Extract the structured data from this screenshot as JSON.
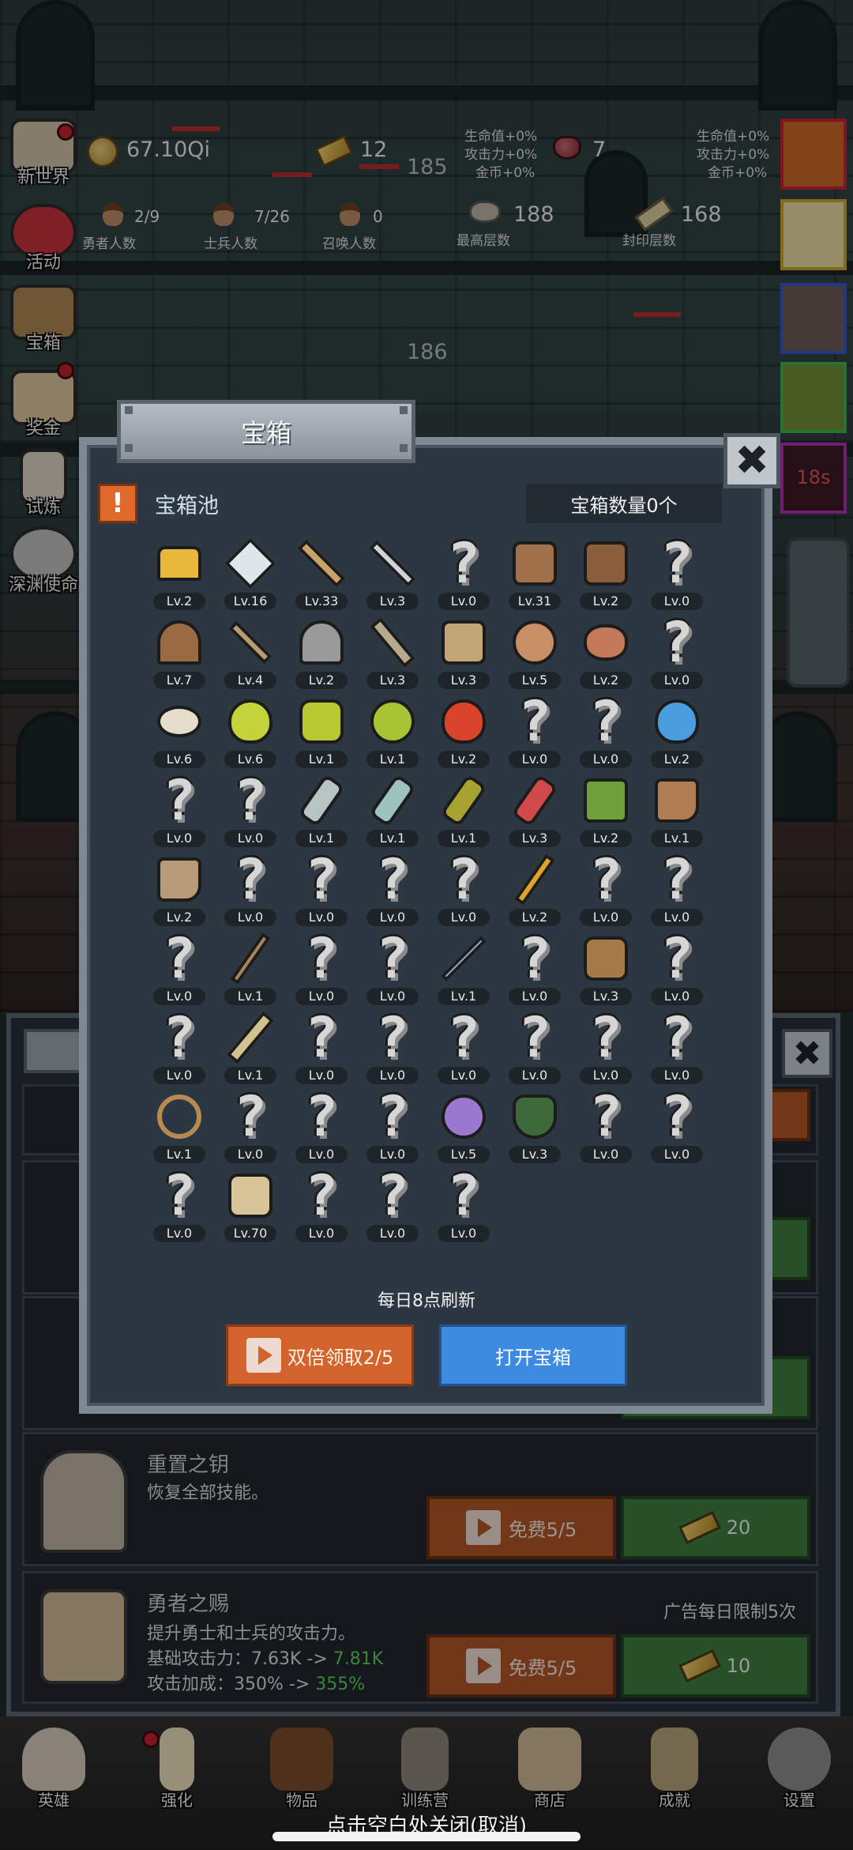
{
  "top_stats": {
    "coins": "67.10Qi",
    "gold": "12",
    "gems": "7",
    "floor_counter_a": "185",
    "floor_counter_b": "186",
    "buffs_left": [
      "生命值+0%",
      "攻击力+0%",
      "金币+0%"
    ],
    "buffs_right": [
      "生命值+0%",
      "攻击力+0%",
      "金币+0%"
    ],
    "heroes_count": "2/9",
    "heroes_label": "勇者人数",
    "soldiers_count": "7/26",
    "soldiers_label": "士兵人数",
    "summon_count": "0",
    "summon_label": "召唤人数",
    "highest_floor": "188",
    "highest_floor_label": "最高层数",
    "sealed_floor": "168",
    "sealed_floor_label": "封印层数"
  },
  "side_menu": [
    "新世界",
    "活动",
    "宝箱",
    "奖金",
    "试炼",
    "深渊使命"
  ],
  "timer": "18s",
  "shop": {
    "rows": [
      {
        "title": "重置之钥",
        "desc": "恢复全部技能。",
        "ad_label": "免费5/5",
        "price": "20"
      },
      {
        "title": "勇者之赐",
        "desc1": "提升勇士和士兵的攻击力。",
        "desc2_prefix": "基础攻击力：7.63K ->",
        "desc2_value": "7.81K",
        "desc3_prefix": "攻击加成：350% ->",
        "desc3_value": "355%",
        "ad_label": "免费5/5",
        "price": "10",
        "ad_limit": "广告每日限制5次"
      }
    ]
  },
  "bottom_nav": [
    "英雄",
    "强化",
    "物品",
    "训练营",
    "商店",
    "成就",
    "设置"
  ],
  "hint": "点击空白处关闭(取消)",
  "modal": {
    "tab_title": "宝箱",
    "close_icon": "✖",
    "warn_icon": "!",
    "pool_title": "宝箱池",
    "chest_count": "宝箱数量0个",
    "refresh_note": "每日8点刷新",
    "double_btn": "双倍领取2/5",
    "open_btn": "打开宝箱",
    "items": [
      {
        "icon": "crown",
        "lv": "Lv.2"
      },
      {
        "icon": "diamond",
        "lv": "Lv.16"
      },
      {
        "icon": "wood-sword",
        "lv": "Lv.33"
      },
      {
        "icon": "iron-sword",
        "lv": "Lv.3"
      },
      {
        "icon": "unknown",
        "lv": "Lv.0"
      },
      {
        "icon": "leather-armor",
        "lv": "Lv.31"
      },
      {
        "icon": "studded-armor",
        "lv": "Lv.2"
      },
      {
        "icon": "unknown",
        "lv": "Lv.0"
      },
      {
        "icon": "leather-helmet",
        "lv": "Lv.7"
      },
      {
        "icon": "dagger",
        "lv": "Lv.4"
      },
      {
        "icon": "knight-helmet",
        "lv": "Lv.2"
      },
      {
        "icon": "hammer",
        "lv": "Lv.3"
      },
      {
        "icon": "great-helm",
        "lv": "Lv.3"
      },
      {
        "icon": "ham",
        "lv": "Lv.5"
      },
      {
        "icon": "steak",
        "lv": "Lv.2"
      },
      {
        "icon": "unknown",
        "lv": "Lv.0"
      },
      {
        "icon": "bread",
        "lv": "Lv.6"
      },
      {
        "icon": "yellow-potion",
        "lv": "Lv.6"
      },
      {
        "icon": "yellow-potion-large",
        "lv": "Lv.1"
      },
      {
        "icon": "green-potion",
        "lv": "Lv.1"
      },
      {
        "icon": "red-potion",
        "lv": "Lv.2"
      },
      {
        "icon": "unknown",
        "lv": "Lv.0"
      },
      {
        "icon": "unknown",
        "lv": "Lv.0"
      },
      {
        "icon": "blue-potion",
        "lv": "Lv.2"
      },
      {
        "icon": "unknown",
        "lv": "Lv.0"
      },
      {
        "icon": "unknown",
        "lv": "Lv.0"
      },
      {
        "icon": "empty-bottle",
        "lv": "Lv.1"
      },
      {
        "icon": "cyan-bottle",
        "lv": "Lv.1"
      },
      {
        "icon": "olive-bottle",
        "lv": "Lv.1"
      },
      {
        "icon": "red-bottle",
        "lv": "Lv.3"
      },
      {
        "icon": "winged-boot",
        "lv": "Lv.2"
      },
      {
        "icon": "leather-boot",
        "lv": "Lv.1"
      },
      {
        "icon": "worn-boot",
        "lv": "Lv.2"
      },
      {
        "icon": "unknown",
        "lv": "Lv.0"
      },
      {
        "icon": "unknown",
        "lv": "Lv.0"
      },
      {
        "icon": "unknown",
        "lv": "Lv.0"
      },
      {
        "icon": "unknown",
        "lv": "Lv.0"
      },
      {
        "icon": "torch",
        "lv": "Lv.2"
      },
      {
        "icon": "unknown",
        "lv": "Lv.0"
      },
      {
        "icon": "unknown",
        "lv": "Lv.0"
      },
      {
        "icon": "unknown",
        "lv": "Lv.0"
      },
      {
        "icon": "wooden-staff",
        "lv": "Lv.1"
      },
      {
        "icon": "unknown",
        "lv": "Lv.0"
      },
      {
        "icon": "unknown",
        "lv": "Lv.0"
      },
      {
        "icon": "magic-wand",
        "lv": "Lv.1"
      },
      {
        "icon": "unknown",
        "lv": "Lv.0"
      },
      {
        "icon": "backpack",
        "lv": "Lv.3"
      },
      {
        "icon": "unknown",
        "lv": "Lv.0"
      },
      {
        "icon": "unknown",
        "lv": "Lv.0"
      },
      {
        "icon": "spiked-club",
        "lv": "Lv.1"
      },
      {
        "icon": "unknown",
        "lv": "Lv.0"
      },
      {
        "icon": "unknown",
        "lv": "Lv.0"
      },
      {
        "icon": "unknown",
        "lv": "Lv.0"
      },
      {
        "icon": "unknown",
        "lv": "Lv.0"
      },
      {
        "icon": "unknown",
        "lv": "Lv.0"
      },
      {
        "icon": "unknown",
        "lv": "Lv.0"
      },
      {
        "icon": "bow",
        "lv": "Lv.1"
      },
      {
        "icon": "unknown",
        "lv": "Lv.0"
      },
      {
        "icon": "unknown",
        "lv": "Lv.0"
      },
      {
        "icon": "unknown",
        "lv": "Lv.0"
      },
      {
        "icon": "tentacle-orb",
        "lv": "Lv.5"
      },
      {
        "icon": "green-shield",
        "lv": "Lv.3"
      },
      {
        "icon": "unknown",
        "lv": "Lv.0"
      },
      {
        "icon": "unknown",
        "lv": "Lv.0"
      },
      {
        "icon": "unknown",
        "lv": "Lv.0"
      },
      {
        "icon": "beer-mug",
        "lv": "Lv.70"
      },
      {
        "icon": "unknown",
        "lv": "Lv.0"
      },
      {
        "icon": "unknown",
        "lv": "Lv.0"
      },
      {
        "icon": "unknown",
        "lv": "Lv.0"
      }
    ]
  },
  "colors": {
    "modal_bg": "#2d3741",
    "accent_orange": "#d2632d",
    "accent_blue": "#3c8be0",
    "buy_green": "#3e7d3f",
    "highlight_green": "#5ccc5c"
  }
}
